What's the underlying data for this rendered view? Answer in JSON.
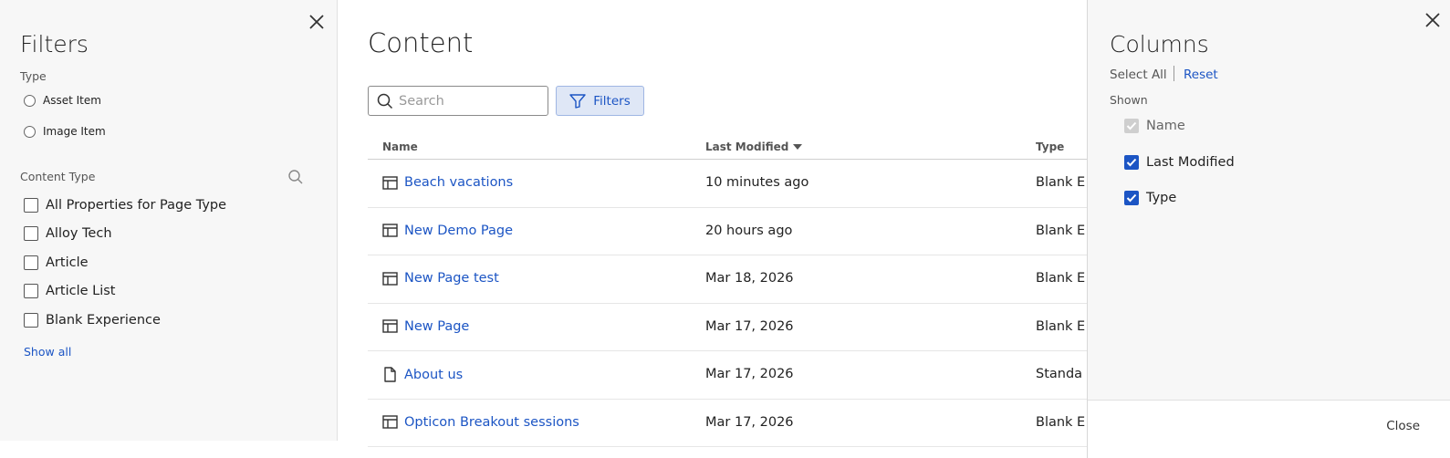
{
  "filters_panel": {
    "title": "Filters",
    "type_label": "Type",
    "type_options": [
      "Asset Item",
      "Image Item"
    ],
    "content_type_label": "Content Type",
    "content_types": [
      "All Properties for Page Type",
      "Alloy Tech",
      "Article",
      "Article List",
      "Blank Experience"
    ],
    "show_all": "Show all"
  },
  "main": {
    "title": "Content",
    "search_placeholder": "Search",
    "filters_button": "Filters",
    "columns": {
      "name": "Name",
      "last_modified": "Last Modified",
      "type": "Type"
    },
    "rows": [
      {
        "icon": "page-layout-icon",
        "name": "Beach vacations",
        "modified": "10 minutes ago",
        "type": "Blank E"
      },
      {
        "icon": "page-layout-icon",
        "name": "New Demo Page",
        "modified": "20 hours ago",
        "type": "Blank E"
      },
      {
        "icon": "page-layout-icon",
        "name": "New Page test",
        "modified": "Mar 18, 2026",
        "type": "Blank E"
      },
      {
        "icon": "page-layout-icon",
        "name": "New Page",
        "modified": "Mar 17, 2026",
        "type": "Blank E"
      },
      {
        "icon": "document-icon",
        "name": "About us",
        "modified": "Mar 17, 2026",
        "type": "Standa"
      },
      {
        "icon": "page-layout-icon",
        "name": "Opticon Breakout sessions",
        "modified": "Mar 17, 2026",
        "type": "Blank E"
      }
    ]
  },
  "columns_panel": {
    "title": "Columns",
    "select_all": "Select All",
    "reset": "Reset",
    "shown_label": "Shown",
    "items": [
      {
        "label": "Name",
        "checked": true,
        "disabled": true
      },
      {
        "label": "Last Modified",
        "checked": true,
        "disabled": false
      },
      {
        "label": "Type",
        "checked": true,
        "disabled": false
      }
    ],
    "close": "Close"
  },
  "colors": {
    "accent": "#1c55c4",
    "panel_bg": "#f7f7f7",
    "filters_button_bg": "#dfe7f6"
  }
}
